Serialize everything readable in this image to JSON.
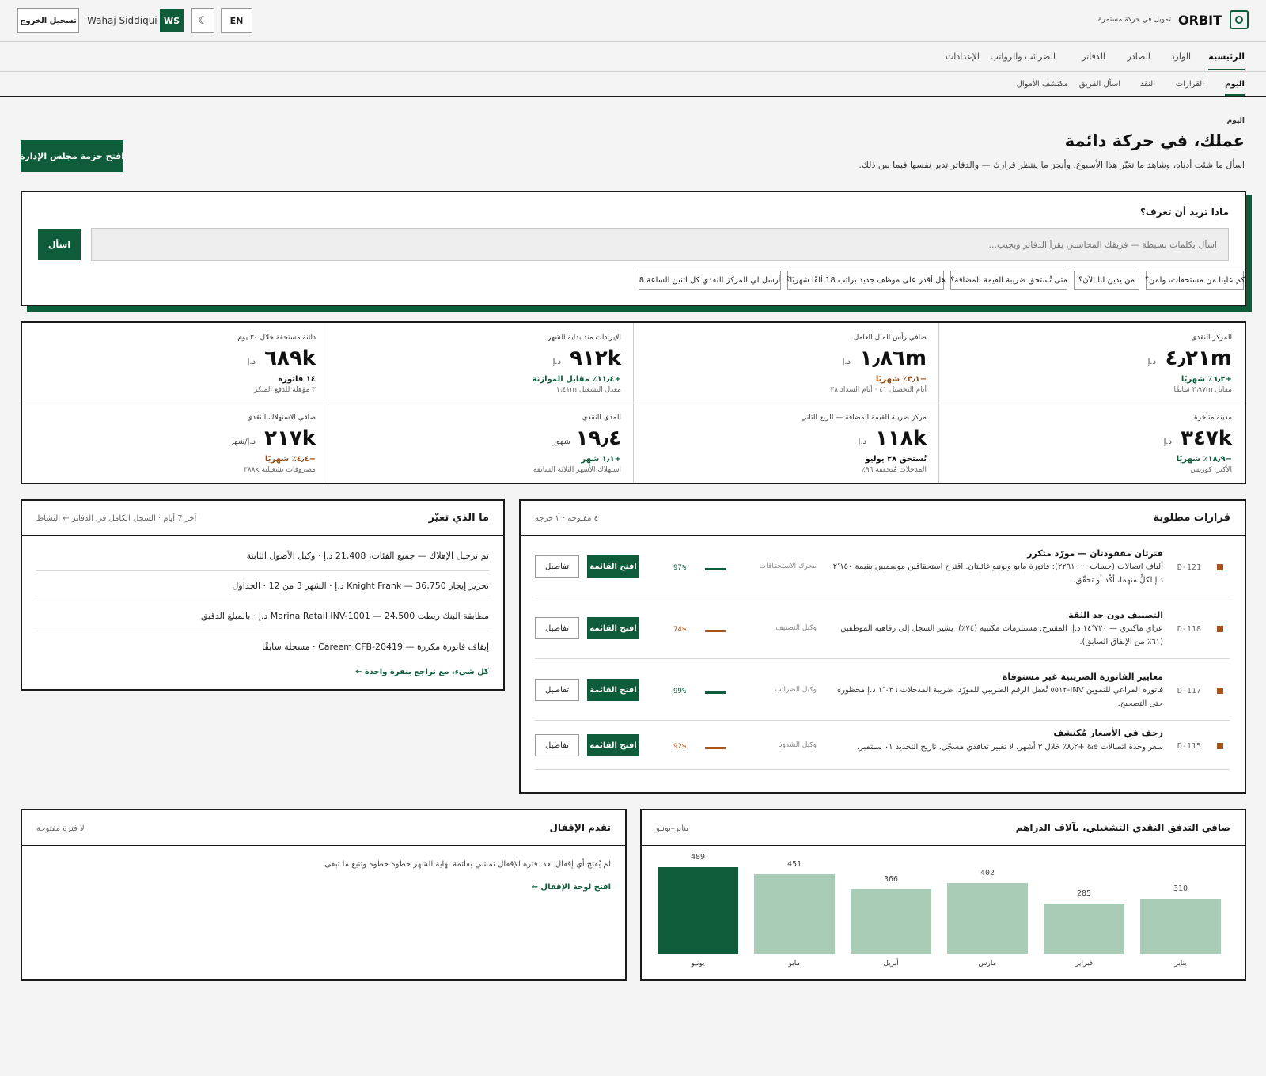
{
  "header": {
    "logo": "ORBIT",
    "tagline": "تمويل في حركة مستمرة",
    "user_name": "Wahaj Siddiqui",
    "avatar": "WS",
    "moon_glyph": "☾",
    "lang": "EN",
    "logout": "تسجيل الخروج"
  },
  "nav": [
    "الرئيسية",
    "الوارد",
    "الصادر",
    "الدفاتر",
    "الضرائب والرواتب",
    "الإعدادات"
  ],
  "subnav": [
    "اليوم",
    "القرارات",
    "النقد",
    "اسأل الفريق",
    "مكتشف الأموال"
  ],
  "hero": {
    "eyebrow": "اليوم",
    "title": "عملك، في حركة دائمة",
    "subtitle": "اسأل ما شئت أدناه، وشاهد ما تغيّر هذا الأسبوع، وأنجز ما ينتظر قرارك — والدفاتر تدير نفسها فيما بين ذلك.",
    "board_pack": "افتح حزمة مجلس الإدارة"
  },
  "ask": {
    "title": "ماذا تريد أن تعرف؟",
    "placeholder": "اسأل بكلمات بسيطة — فريقك المحاسبي يقرأ الدفاتر ويجيب...",
    "button": "اسأل",
    "chips": [
      "كم علينا من مستحقات، ولمن؟",
      "من يدين لنا الآن؟",
      "متى تُستحق ضريبة القيمة المضافة؟",
      "هل أقدر على موظف جديد براتب 18 ألفًا شهريًا؟",
      "أرسل لي المركز النقدي كل اثنين الساعة 8"
    ]
  },
  "kpis": [
    {
      "label": "المركز النقدي",
      "value": "٤٫٢١m",
      "unit": "د.إ",
      "delta": "+٦٫٢٪ شهريًا",
      "trend": "up",
      "sub": "مقابل ٣٫٩٧m سابقًا"
    },
    {
      "label": "صافي رأس المال العامل",
      "value": "١٫٨٦m",
      "unit": "د.إ",
      "delta": "−٣٫١٪ شهريًا",
      "trend": "down",
      "sub": "أيام التحصيل ٤١ · أيام السداد ٣٨"
    },
    {
      "label": "الإيرادات منذ بداية الشهر",
      "value": "٩١٢k",
      "unit": "د.إ",
      "delta": "+١١٫٤٪ مقابل الموازنة",
      "trend": "up",
      "sub": "معدل التشغيل ١٫٤١m"
    },
    {
      "label": "دائنة مستحقة خلال ٣٠ يوم",
      "value": "٦٨٩k",
      "unit": "د.إ",
      "delta": "١٤ فاتورة",
      "trend": "neutral",
      "sub": "٣ مؤهلة للدفع المبكر"
    },
    {
      "label": "مدينة متأخرة",
      "value": "٣٤٧k",
      "unit": "د.إ",
      "delta": "−١٨٫٩٪ شهريًا",
      "trend": "down",
      "sub": "الأكبر: كوريس"
    },
    {
      "label": "مركز ضريبة القيمة المضافة — الربع الثاني",
      "value": "١١٨k",
      "unit": "د.إ",
      "delta": "تُستحق ٢٨ يوليو",
      "trend": "neutral",
      "sub": "المدخلات مُتحققة ٩٦٪"
    },
    {
      "label": "المدى النقدي",
      "value": "١٩٫٤",
      "unit": "شهور",
      "delta": "+١٫١ شهر",
      "trend": "up",
      "sub": "استهلاك الأشهر الثلاثة السابقة"
    },
    {
      "label": "صافي الاستهلاك النقدي",
      "value": "٢١٧k",
      "unit": "د.إ/شهر",
      "delta": "−٤٫٤٪ شهريًا",
      "trend": "down",
      "sub": "مصروفات تشغيلية ٣٨٨k"
    }
  ],
  "decisions": {
    "title": "قرارات مطلوبة",
    "meta": "٤ مفتوحة · ٢ حرجة",
    "open_label": "افتح القائمة",
    "details_label": "تفاصيل",
    "items": [
      {
        "id": "D-121",
        "title": "فترتان مفقودتان — مورّد متكرر",
        "desc": "ألياف اتصالات (حساب ···· ٢٢٩١): فاتورة مايو ويونيو غائبتان. اقترح استحقاقين موسميين بقيمة ٢٬١٥٠ د.إ لكلٍّ منهما، أكّد أو تحقّق.",
        "agent": "محرك الاستحقاقات",
        "confidence": "97%",
        "conf_color": "#0e5c3a"
      },
      {
        "id": "D-118",
        "title": "التصنيف دون حد الثقة",
        "desc": "عراي ماكنزي — ١٤٬٧٢٠ د.إ. المقترح: مستلزمات مكتبية (٧٤٪). يشير السجل إلى رفاهية الموظفين (٦١٪ من الإنفاق السابق).",
        "agent": "وكيل التصنيف",
        "confidence": "74%",
        "conf_color": "#a4541c"
      },
      {
        "id": "D-117",
        "title": "معايير الفاتورة الضريبية غير مستوفاة",
        "desc": "فاتورة المراعي للتموين INV-٥٥١٢ تُغفل الرقم الضريبي للمورّد. ضريبة المدخلات ١٬٠٣٦ د.إ محظورة حتى التصحيح.",
        "agent": "وكيل الضرائب",
        "confidence": "99%",
        "conf_color": "#0e5c3a"
      },
      {
        "id": "D-115",
        "title": "زحف في الأسعار مُكتشف",
        "desc": "سعر وحدة اتصالات e& +٨٫٢٪ خلال ٣ أشهر. لا تغيير تعاقدي مسجّل. تاريخ التجديد ٠١ سبتمبر.",
        "agent": "وكيل الشذوذ",
        "confidence": "92%",
        "conf_color": "#a4541c"
      }
    ]
  },
  "changes": {
    "title": "ما الذي تغيّر",
    "meta": "آخر 7 أيام · السجل الكامل في الدفاتر ← النشاط",
    "items": [
      "تم ترحيل الإهلاك — جميع الفئات، 21,408 د.إ · وكيل الأصول الثابتة",
      "تحرير إيجار Knight Frank — 36,750 د.إ · الشهر 3 من 12 · الجداول",
      "مطابقة البنك ربطت Marina Retail INV-1001 — 24,500 د.إ · بالمبلغ الدقيق",
      "إيقاف فاتورة مكررة — Careem CFB-20419 · مسجلة سابقًا"
    ],
    "link": "كل شيء، مع تراجع بنقرة واحدة ←"
  },
  "cashflow": {
    "title": "صافي التدفق النقدي التشغيلي، بآلاف الدراهم",
    "range": "يناير–يونيو"
  },
  "chart_data": {
    "type": "bar",
    "title": "صافي التدفق النقدي التشغيلي، بآلاف الدراهم",
    "categories": [
      "يناير",
      "فبراير",
      "مارس",
      "أبريل",
      "مايو",
      "يونيو"
    ],
    "values": [
      310,
      285,
      402,
      366,
      451,
      489
    ],
    "ylim": [
      0,
      489
    ],
    "highlight_index": 5,
    "colors": {
      "base": "#a8ccb6",
      "highlight": "#0e5c3a"
    },
    "grid": false
  },
  "close": {
    "title": "تقدم الإقفال",
    "meta": "لا فترة مفتوحة",
    "body": "لم يُفتح أي إقفال بعد. فترة الإقفال تمشي بقائمة نهاية الشهر خطوة خطوة وتتبع ما تبقى.",
    "link": "افتح لوحة الإقفال ←"
  }
}
